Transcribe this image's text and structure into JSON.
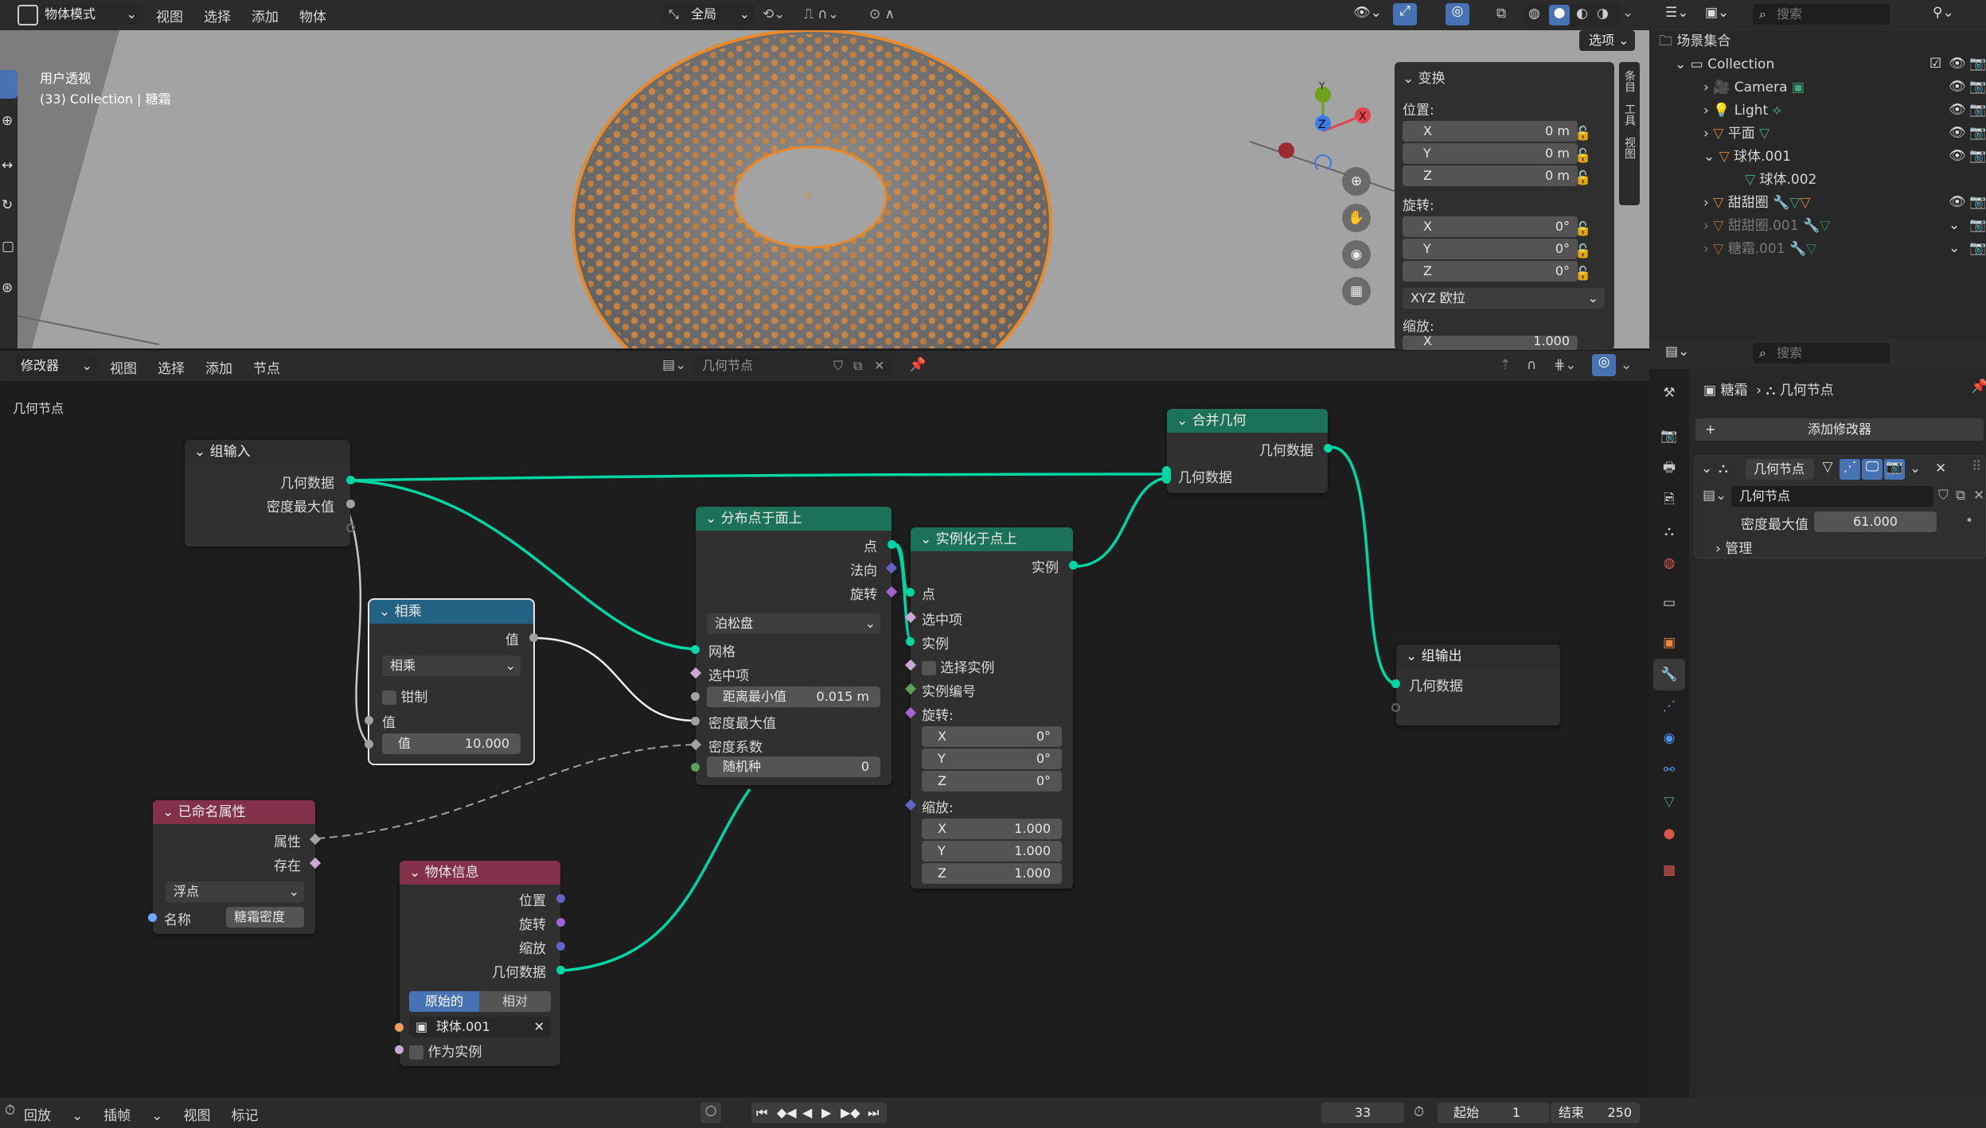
{
  "top": {
    "mode": "物体模式",
    "menu": [
      "视图",
      "选择",
      "添加",
      "物体"
    ],
    "transform_orientation": "全局",
    "options": "选项"
  },
  "viewport": {
    "perspective": "用户透视",
    "collection": "(33) Collection | 糖霜",
    "axes": {
      "x": "X",
      "y": "Y",
      "z": "Z"
    }
  },
  "npanel": {
    "title": "变换",
    "location": "位置:",
    "rotation": "旋转:",
    "scale": "缩放:",
    "loc": [
      {
        "a": "X",
        "v": "0 m"
      },
      {
        "a": "Y",
        "v": "0 m"
      },
      {
        "a": "Z",
        "v": "0 m"
      }
    ],
    "rot": [
      {
        "a": "X",
        "v": "0°"
      },
      {
        "a": "Y",
        "v": "0°"
      },
      {
        "a": "Z",
        "v": "0°"
      }
    ],
    "rot_mode": "XYZ 欧拉",
    "scale_x": {
      "a": "X",
      "v": "1.000"
    },
    "tabs": [
      "条目",
      "工具",
      "视图"
    ]
  },
  "outliner": {
    "search": "搜索",
    "scene_collection": "场景集合",
    "collection": "Collection",
    "items": [
      "Camera",
      "Light",
      "平面",
      "球体.001",
      "球体.002",
      "甜甜圈",
      "甜甜圈.001",
      "糖霜.001"
    ]
  },
  "node_header": {
    "editor": "修改器",
    "menu": [
      "视图",
      "选择",
      "添加",
      "节点"
    ],
    "tree": "几何节点",
    "breadcrumb": "几何节点"
  },
  "nodes": {
    "group_input": {
      "title": "组输入",
      "geometry": "几何数据",
      "density_max": "密度最大值"
    },
    "multiply": {
      "title": "相乘",
      "value_out": "值",
      "op": "相乘",
      "clamp": "钳制",
      "value_in": "值",
      "value_field": "值",
      "value_num": "10.000"
    },
    "named_attr": {
      "title": "已命名属性",
      "attribute": "属性",
      "exists": "存在",
      "type": "浮点",
      "name": "名称",
      "name_val": "糖霜密度"
    },
    "distribute": {
      "title": "分布点于面上",
      "points": "点",
      "normal": "法向",
      "rotation": "旋转",
      "method": "泊松盘",
      "mesh": "网格",
      "selection": "选中项",
      "dist_min": "距离最小值",
      "dist_min_val": "0.015 m",
      "density_max": "密度最大值",
      "density_factor": "密度系数",
      "seed": "随机种",
      "seed_val": "0"
    },
    "instance": {
      "title": "实例化于点上",
      "instances_out": "实例",
      "points": "点",
      "selection": "选中项",
      "instance": "实例",
      "pick": "选择实例",
      "index": "实例编号",
      "rotation": "旋转:",
      "rot": [
        {
          "a": "X",
          "v": "0°"
        },
        {
          "a": "Y",
          "v": "0°"
        },
        {
          "a": "Z",
          "v": "0°"
        }
      ],
      "scale": "缩放:",
      "sc": [
        {
          "a": "X",
          "v": "1.000"
        },
        {
          "a": "Y",
          "v": "1.000"
        },
        {
          "a": "Z",
          "v": "1.000"
        }
      ]
    },
    "join": {
      "title": "合并几何",
      "geometry_out": "几何数据",
      "geometry_in": "几何数据"
    },
    "group_output": {
      "title": "组输出",
      "geometry": "几何数据"
    },
    "object_info": {
      "title": "物体信息",
      "location": "位置",
      "rotation": "旋转",
      "scale": "缩放",
      "geometry": "几何数据",
      "original": "原始的",
      "relative": "相对",
      "object": "球体.001",
      "as_instance": "作为实例"
    }
  },
  "properties": {
    "search": "搜索",
    "object": "糖霜",
    "modifier_path": "几何节点",
    "add_modifier": "添加修改器",
    "modifier_name": "几何节点",
    "tree": "几何节点",
    "density_label": "密度最大值",
    "density_value": "61.000",
    "manage": "管理"
  },
  "timeline": {
    "menu": [
      "回放",
      "插帧",
      "视图",
      "标记"
    ],
    "frame": "33",
    "start_label": "起始",
    "start": "1",
    "end_label": "结束",
    "end": "250"
  },
  "colors": {
    "geometry": "#00d6a3",
    "float": "#a1a1a1",
    "vector": "#6363c7",
    "rotation": "#a363d4",
    "bool": "#cca6d6",
    "int": "#5a9e5a",
    "string": "#6fa8ff",
    "group_header": "#2d2d2d",
    "math_header": "#246283",
    "attr_header": "#83314a",
    "geo_header": "#1c7258",
    "accent": "#4772b3"
  }
}
